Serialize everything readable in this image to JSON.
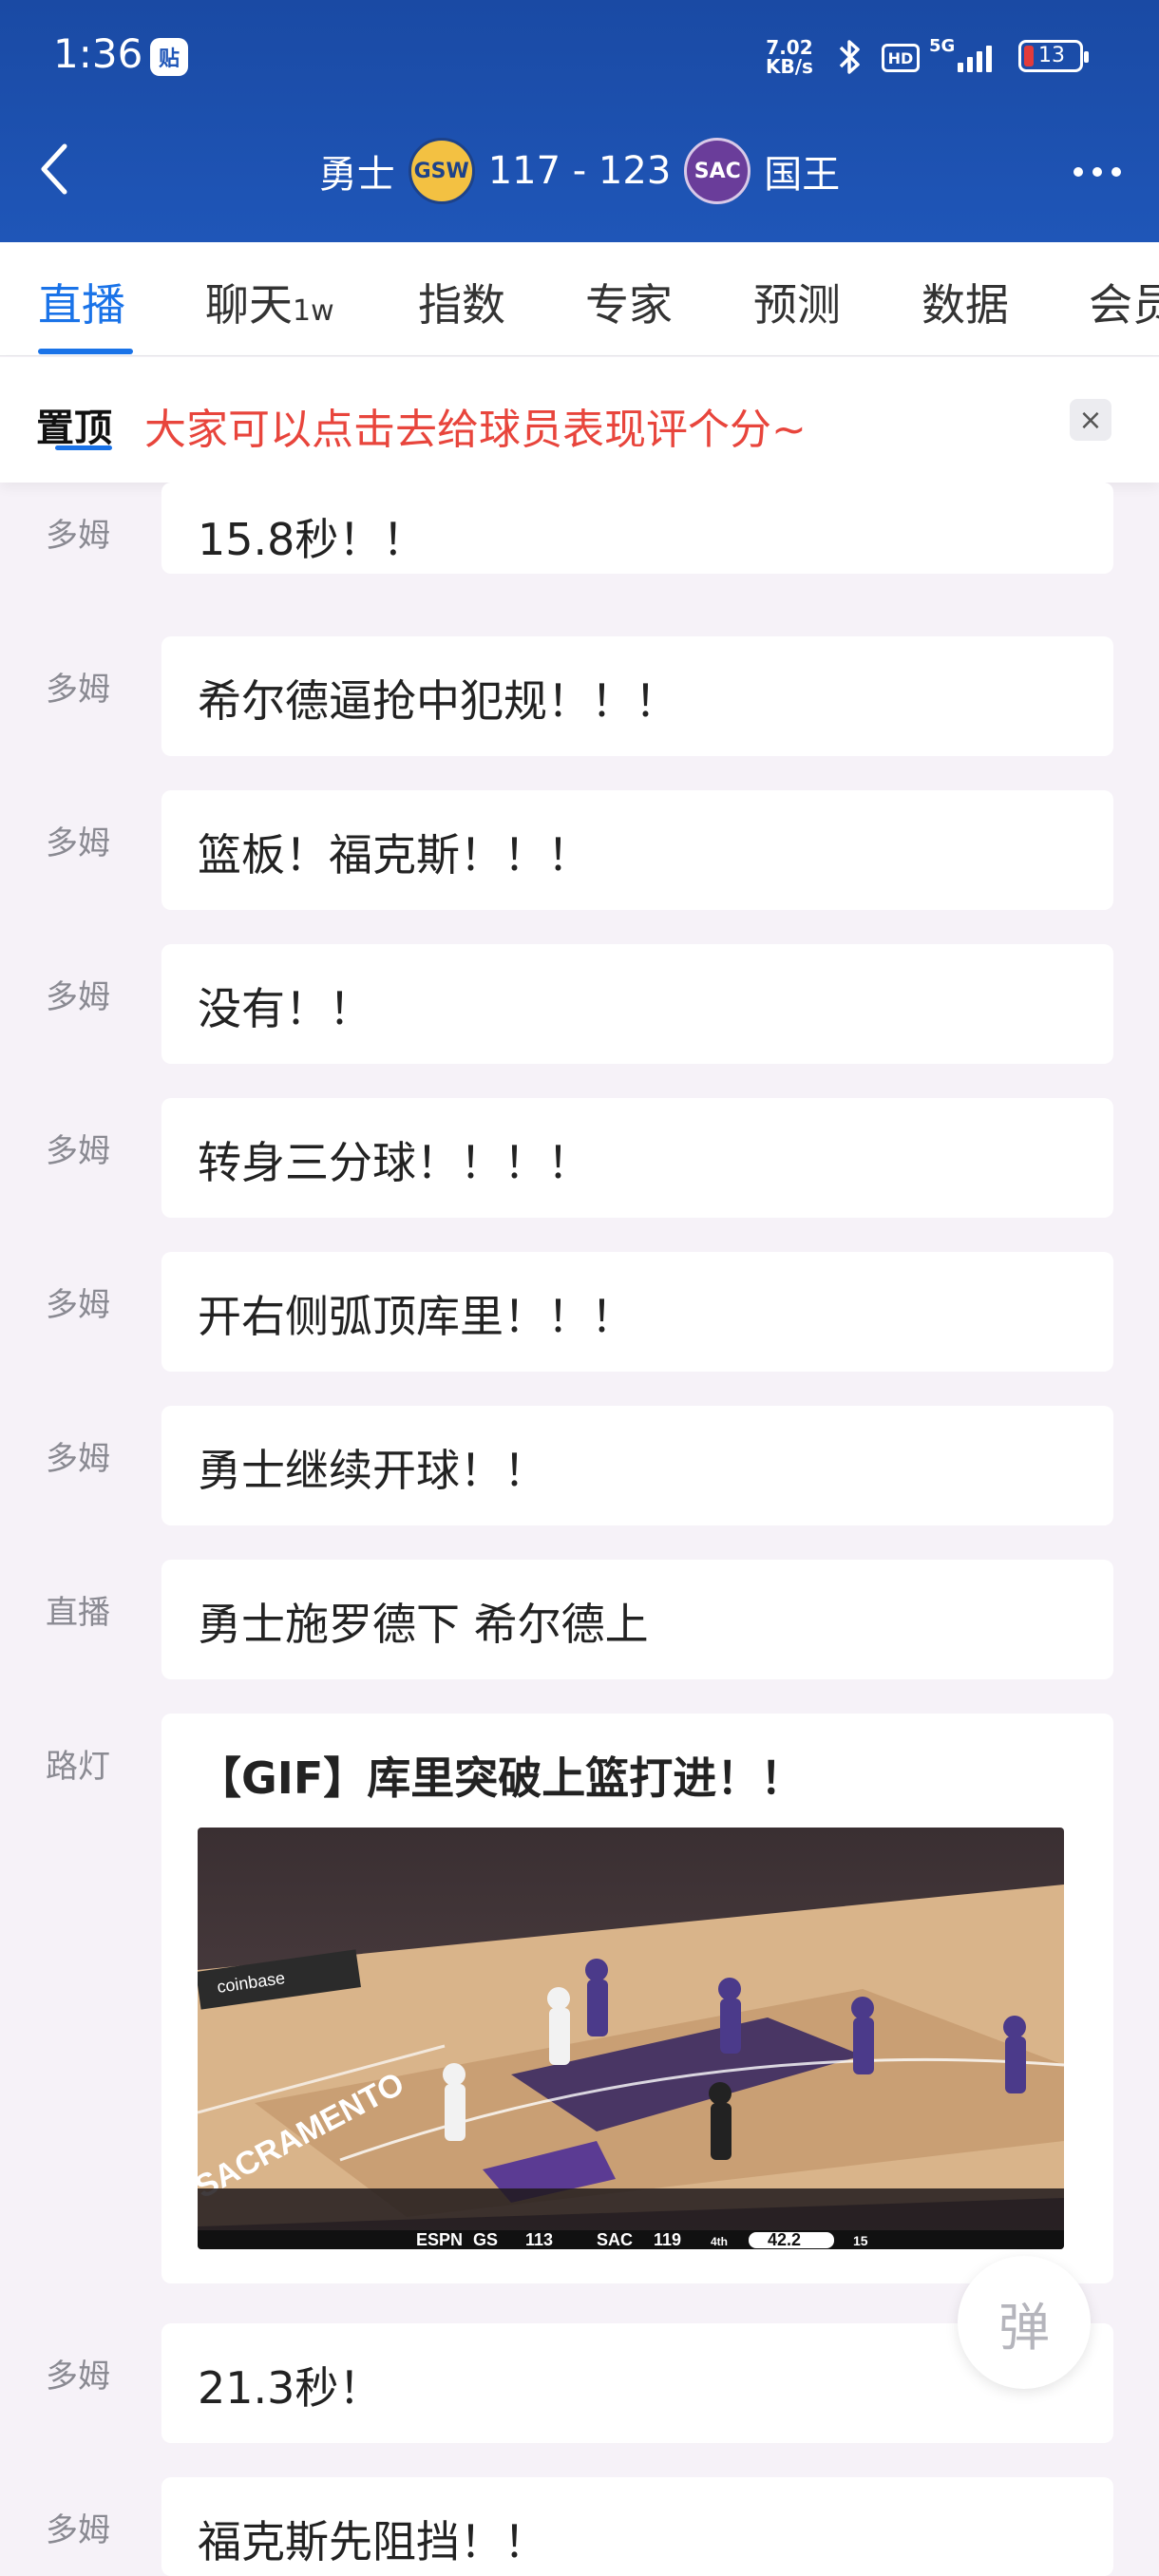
{
  "status_bar": {
    "time": "1:36",
    "app_badge": "贴",
    "net_speed_value": "7.02",
    "net_speed_unit": "KB/s",
    "hd": "HD",
    "network": "5G",
    "battery": "13"
  },
  "header": {
    "home_team": "勇士",
    "home_abbr": "GSW",
    "score": "117 - 123",
    "away_abbr": "SAC",
    "away_team": "国王"
  },
  "tabs": [
    {
      "label": "直播",
      "sub": ""
    },
    {
      "label": "聊天",
      "sub": "1w"
    },
    {
      "label": "指数",
      "sub": ""
    },
    {
      "label": "专家",
      "sub": ""
    },
    {
      "label": "预测",
      "sub": ""
    },
    {
      "label": "数据",
      "sub": ""
    },
    {
      "label": "会员",
      "sub": ""
    }
  ],
  "pinned": {
    "tag": "置顶",
    "text": "大家可以点击去给球员表现评个分~",
    "close": "×"
  },
  "feed": [
    {
      "author": "多姆",
      "text": "15.8秒！！"
    },
    {
      "author": "多姆",
      "text": "希尔德逼抢中犯规！！！"
    },
    {
      "author": "多姆",
      "text": "篮板！福克斯！！！"
    },
    {
      "author": "多姆",
      "text": "没有！！"
    },
    {
      "author": "多姆",
      "text": "转身三分球！！！！"
    },
    {
      "author": "多姆",
      "text": "开右侧弧顶库里！！！"
    },
    {
      "author": "多姆",
      "text": "勇士继续开球！！"
    },
    {
      "author": "直播",
      "text": "勇士施罗德下 希尔德上"
    },
    {
      "author": "路灯",
      "text": "【GIF】库里突破上篮打进！！"
    },
    {
      "author": "多姆",
      "text": "21.3秒！"
    },
    {
      "author": "多姆",
      "text": "福克斯先阻挡！！"
    }
  ],
  "gif_scoreboard": {
    "network": "ESPN",
    "home": "GS",
    "home_score": "113",
    "away": "SAC",
    "away_score": "119",
    "period": "4th",
    "clock": "42.2",
    "shot_clock": "15",
    "court_text": "SACRAMENTO",
    "ad_text": "coinbase"
  },
  "danmaku_button": "弹"
}
